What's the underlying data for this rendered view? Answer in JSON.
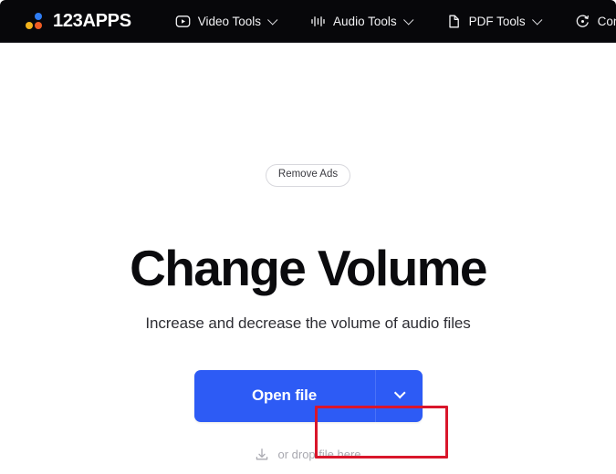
{
  "header": {
    "logo": {
      "text": "123APPS",
      "dots": [
        {
          "name": "logo-dot-blue",
          "color": "#2f7df4"
        },
        {
          "name": "logo-dot-yellow",
          "color": "#f2b21c"
        },
        {
          "name": "logo-dot-orange",
          "color": "#ef5c24"
        }
      ]
    },
    "nav": [
      {
        "label": "Video Tools",
        "icon": "play-square-icon",
        "has_chevron": true
      },
      {
        "label": "Audio Tools",
        "icon": "waveform-icon",
        "has_chevron": true
      },
      {
        "label": "PDF Tools",
        "icon": "document-icon",
        "has_chevron": true
      },
      {
        "label": "Converters",
        "icon": "refresh-circle-icon",
        "has_chevron": true
      }
    ],
    "background_color": "#07070a"
  },
  "main": {
    "remove_ads_label": "Remove Ads",
    "title": "Change Volume",
    "subtitle": "Increase and decrease the volume of audio files",
    "open_file_label": "Open file",
    "dropdown_icon": "chevron-down-icon",
    "drop_hint_label": "or drop file here",
    "drop_hint_icon": "download-icon",
    "accent_color": "#2d5bf5",
    "annotation_color": "#d9162b"
  }
}
